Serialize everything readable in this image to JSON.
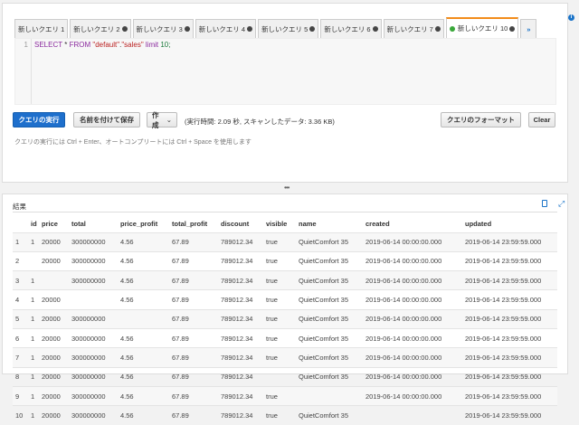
{
  "tabs": [
    {
      "label": "新しいクエリ 1",
      "closable": false
    },
    {
      "label": "新しいクエリ 2",
      "closable": true
    },
    {
      "label": "新しいクエリ 3",
      "closable": true
    },
    {
      "label": "新しいクエリ 4",
      "closable": true
    },
    {
      "label": "新しいクエリ 5",
      "closable": true
    },
    {
      "label": "新しいクエリ 6",
      "closable": true
    },
    {
      "label": "新しいクエリ 7",
      "closable": true
    },
    {
      "label": "新しいクエリ 10",
      "closable": true,
      "active": true
    }
  ],
  "more_tabs": "»",
  "editor": {
    "line": "1",
    "tokens": [
      [
        "kw",
        "SELECT"
      ],
      [
        "",
        "*"
      ],
      [
        "kw",
        "FROM"
      ],
      [
        "str",
        "\"default\""
      ],
      [
        "",
        "."
      ],
      [
        "str",
        "\"sales\""
      ],
      [
        "kw",
        "limit"
      ],
      [
        "num",
        "10;"
      ]
    ]
  },
  "toolbar": {
    "run": "クエリの実行",
    "save_as": "名前を付けて保存",
    "create": "作成",
    "stats": "(実行時間: 2.09 秒, スキャンしたデータ: 3.36 KB)",
    "format": "クエリのフォーマット",
    "clear": "Clear"
  },
  "hint": "クエリの実行には Ctrl + Enter、オートコンプリートには Ctrl + Space を使用します",
  "results": {
    "title": "結果",
    "columns": [
      "",
      "id",
      "price",
      "total",
      "price_profit",
      "total_profit",
      "discount",
      "visible",
      "name",
      "created",
      "updated"
    ],
    "rows": [
      [
        "1",
        "1",
        "20000",
        "300000000",
        "4.56",
        "67.89",
        "789012.34",
        "true",
        "QuietComfort 35",
        "2019-06-14 00:00:00.000",
        "2019-06-14 23:59:59.000"
      ],
      [
        "2",
        "",
        "20000",
        "300000000",
        "4.56",
        "67.89",
        "789012.34",
        "true",
        "QuietComfort 35",
        "2019-06-14 00:00:00.000",
        "2019-06-14 23:59:59.000"
      ],
      [
        "3",
        "1",
        "",
        "300000000",
        "4.56",
        "67.89",
        "789012.34",
        "true",
        "QuietComfort 35",
        "2019-06-14 00:00:00.000",
        "2019-06-14 23:59:59.000"
      ],
      [
        "4",
        "1",
        "20000",
        "",
        "4.56",
        "67.89",
        "789012.34",
        "true",
        "QuietComfort 35",
        "2019-06-14 00:00:00.000",
        "2019-06-14 23:59:59.000"
      ],
      [
        "5",
        "1",
        "20000",
        "300000000",
        "",
        "67.89",
        "789012.34",
        "true",
        "QuietComfort 35",
        "2019-06-14 00:00:00.000",
        "2019-06-14 23:59:59.000"
      ],
      [
        "6",
        "1",
        "20000",
        "300000000",
        "4.56",
        "67.89",
        "789012.34",
        "true",
        "QuietComfort 35",
        "2019-06-14 00:00:00.000",
        "2019-06-14 23:59:59.000"
      ],
      [
        "7",
        "1",
        "20000",
        "300000000",
        "4.56",
        "67.89",
        "789012.34",
        "true",
        "QuietComfort 35",
        "2019-06-14 00:00:00.000",
        "2019-06-14 23:59:59.000"
      ],
      [
        "8",
        "1",
        "20000",
        "300000000",
        "4.56",
        "67.89",
        "789012.34",
        "",
        "QuietComfort 35",
        "2019-06-14 00:00:00.000",
        "2019-06-14 23:59:59.000"
      ],
      [
        "9",
        "1",
        "20000",
        "300000000",
        "4.56",
        "67.89",
        "789012.34",
        "true",
        "",
        "2019-06-14 00:00:00.000",
        "2019-06-14 23:59:59.000"
      ],
      [
        "10",
        "1",
        "20000",
        "300000000",
        "4.56",
        "67.89",
        "789012.34",
        "true",
        "QuietComfort 35",
        "",
        "2019-06-14 23:59:59.000"
      ]
    ]
  }
}
